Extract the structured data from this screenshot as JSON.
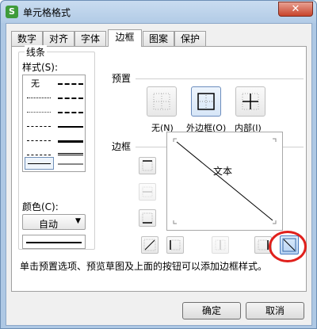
{
  "window": {
    "title": "单元格格式",
    "app_icon_glyph": "S",
    "close_glyph": "✕"
  },
  "tabs": [
    {
      "label": "数字"
    },
    {
      "label": "对齐"
    },
    {
      "label": "字体"
    },
    {
      "label": "边框",
      "active": true
    },
    {
      "label": "图案"
    },
    {
      "label": "保护"
    }
  ],
  "line_group": {
    "title": "线条",
    "style_label": "样式(S):",
    "none_label": "无",
    "color_label": "颜色(C):",
    "color_value": "自动",
    "color_swatch": "#000000"
  },
  "preset_group": {
    "title": "预置",
    "buttons": [
      {
        "label": "无(N)",
        "icon": "no-border-icon"
      },
      {
        "label": "外边框(O)",
        "icon": "outline-border-icon",
        "selected": true
      },
      {
        "label": "内部(I)",
        "icon": "inside-border-icon"
      }
    ]
  },
  "border_group": {
    "title": "边框",
    "preview_text": "文本",
    "left_buttons": [
      {
        "icon": "top-border-icon"
      },
      {
        "icon": "inside-horizontal-border-icon",
        "disabled": true
      },
      {
        "icon": "bottom-border-icon"
      }
    ],
    "bottom_buttons": [
      {
        "icon": "diagonal-up-border-icon"
      },
      {
        "icon": "left-border-icon"
      },
      {
        "icon": "inside-vertical-border-icon",
        "disabled": true
      },
      {
        "icon": "right-border-icon"
      },
      {
        "icon": "diagonal-down-border-icon",
        "active": true
      }
    ],
    "highlight_color": "#e0201c"
  },
  "hint": "单击预置选项、预览草图及上面的按钮可以添加边框样式。",
  "buttons": {
    "ok": "确定",
    "cancel": "取消"
  },
  "colors": {
    "title_bar": "#b2cbe6",
    "close_button": "#c8442b",
    "selection": "#4a7cc0"
  }
}
